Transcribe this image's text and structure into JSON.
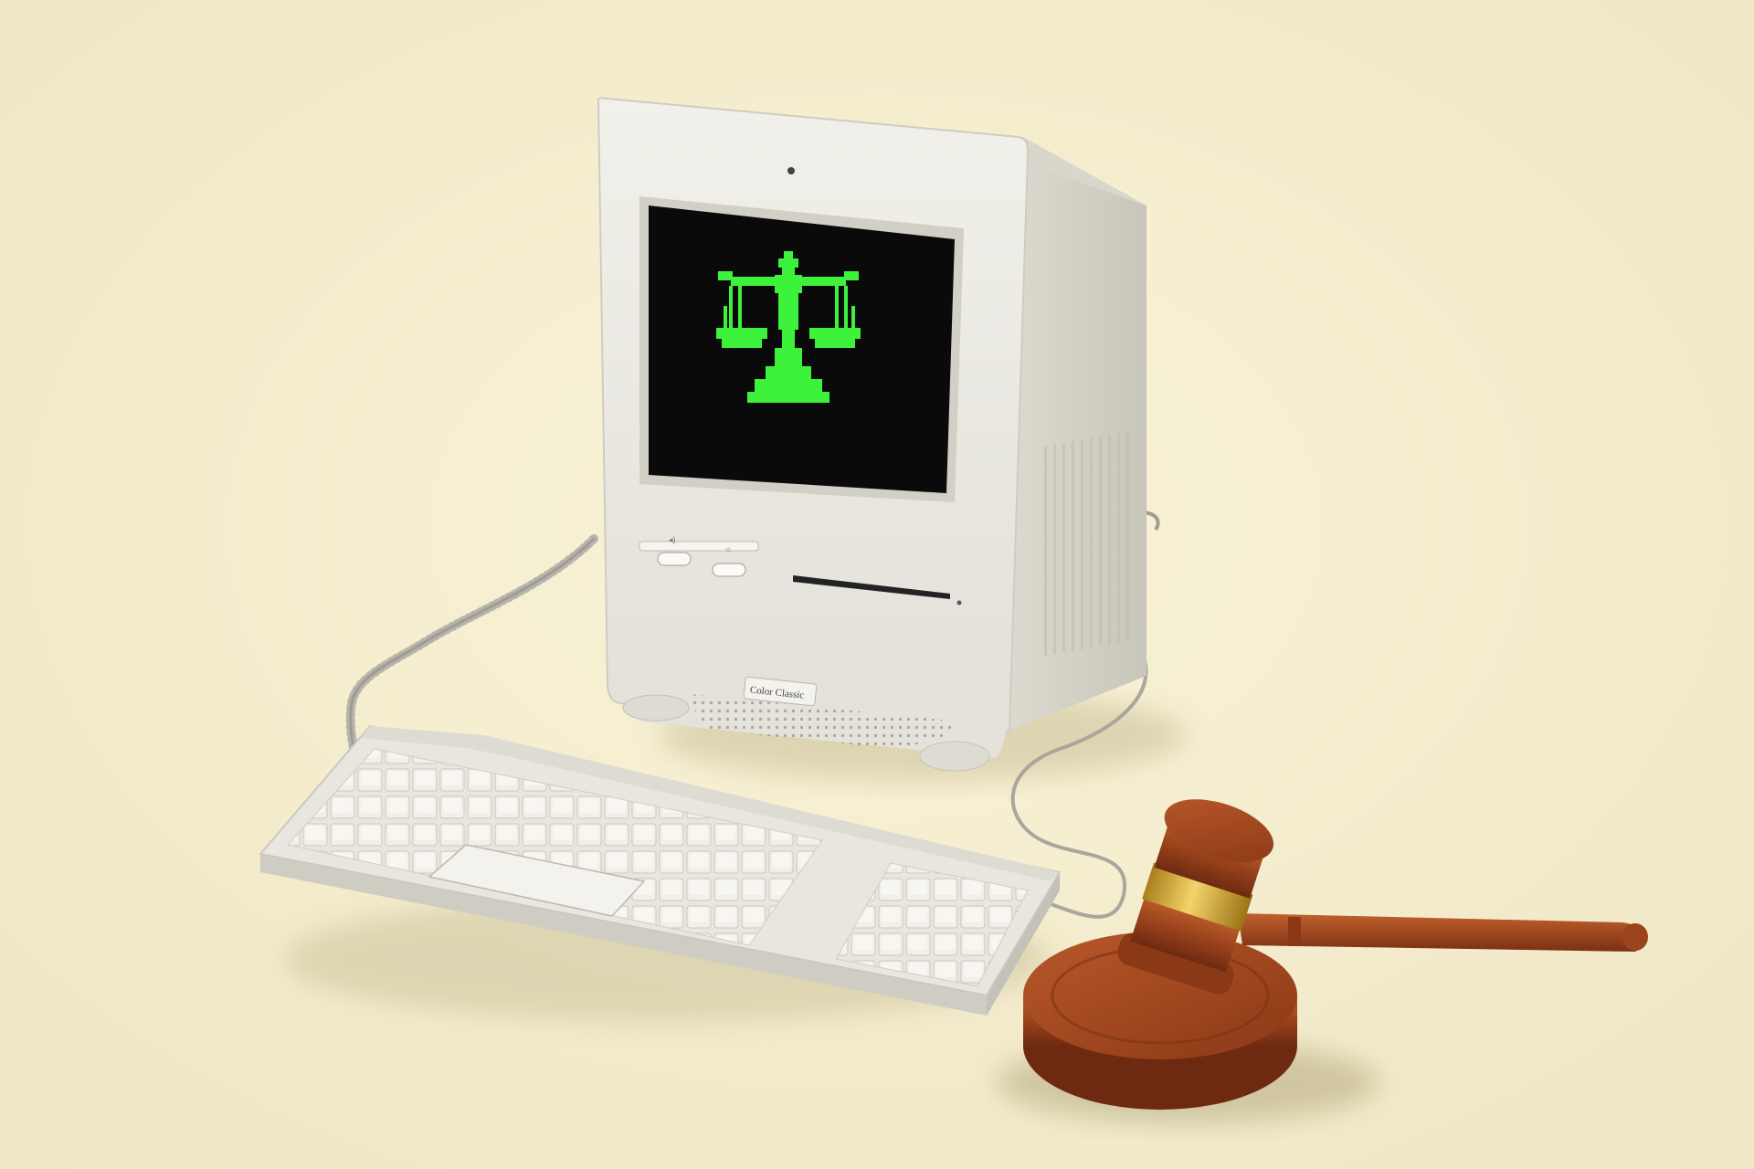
{
  "scene": {
    "computer_badge": "Color Classic"
  },
  "colors": {
    "background": "#f6efcf",
    "plastic": "#e9e7df",
    "plastic_shade": "#cfccc2",
    "screen": "#0a0a0a",
    "pixel_green": "#3df23a",
    "wood": "#a0471f",
    "wood_dark": "#6e2a10",
    "brass": "#e2b43a"
  },
  "icons": [
    "scales-of-justice-icon",
    "gavel",
    "keyboard",
    "computer"
  ]
}
